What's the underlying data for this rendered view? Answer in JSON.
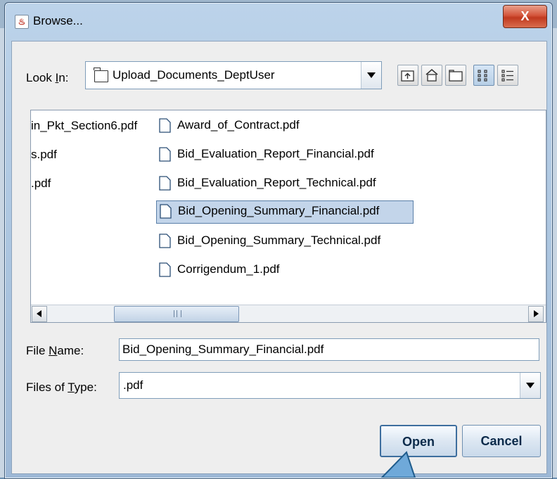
{
  "window": {
    "title": "Browse...",
    "close_label": "X"
  },
  "look_in": {
    "label_pre": "Look ",
    "label_key": "I",
    "label_post": "n:",
    "value": "Upload_Documents_DeptUser"
  },
  "toolbar": {
    "icons": [
      "up-folder-icon",
      "home-icon",
      "new-folder-icon",
      "list-view-icon",
      "details-view-icon"
    ]
  },
  "file_list": {
    "left_column": [
      "in_Pkt_Section6.pdf",
      "s.pdf",
      ".pdf"
    ],
    "files": [
      "Award_of_Contract.pdf",
      "Bid_Evaluation_Report_Financial.pdf",
      "Bid_Evaluation_Report_Technical.pdf",
      "Bid_Opening_Summary_Financial.pdf",
      "Bid_Opening_Summary_Technical.pdf",
      "Corrigendum_1.pdf"
    ],
    "selected_file": "Bid_Opening_Summary_Financial.pdf"
  },
  "file_name": {
    "label_pre": "File ",
    "label_key": "N",
    "label_post": "ame:",
    "value": "Bid_Opening_Summary_Financial.pdf"
  },
  "file_type": {
    "label_pre": "Files of ",
    "label_key": "T",
    "label_post": "ype:",
    "value": ".pdf"
  },
  "buttons": {
    "open": "Open",
    "cancel": "Cancel"
  },
  "colors": {
    "selection": "#c3d5ea",
    "window_frame": "#a9c3de",
    "close_button": "#c0391f"
  }
}
